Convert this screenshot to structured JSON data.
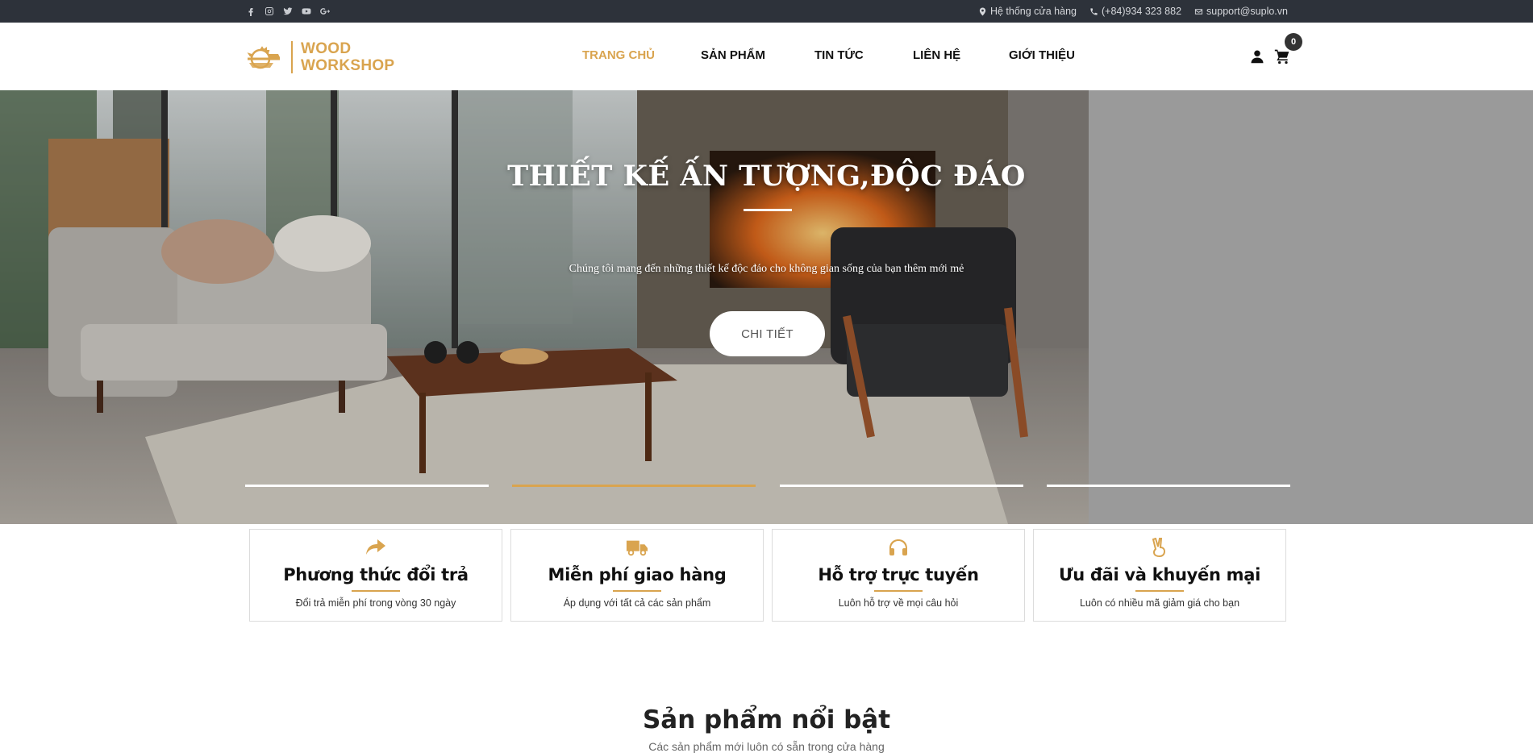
{
  "topbar": {
    "socials": [
      "facebook-icon",
      "instagram-icon",
      "twitter-icon",
      "youtube-icon",
      "google-plus-icon"
    ],
    "store_label": "Hệ thống cửa hàng",
    "phone": "(+84)934 323 882",
    "email": "support@suplo.vn"
  },
  "header": {
    "logo_line1": "WOOD",
    "logo_line2": "WORKSHOP",
    "nav": [
      "TRANG CHỦ",
      "SẢN PHẨM",
      "TIN TỨC",
      "LIÊN HỆ",
      "GIỚI THIỆU"
    ],
    "active_nav": "TRANG CHỦ",
    "cart_count": "0"
  },
  "hero": {
    "title": "THIẾT KẾ ẤN TƯỢNG,ĐỘC ĐÁO",
    "subtitle": "Chúng tôi mang đến những thiết kế độc đáo cho không gian sống của bạn thêm mới mẻ",
    "button": "CHI TIẾT",
    "slides": 4,
    "active_slide": 2
  },
  "features": [
    {
      "icon": "share-arrow-icon",
      "title": "Phương thức đổi trả",
      "desc": "Đổi trả miễn phí trong vòng 30 ngày"
    },
    {
      "icon": "truck-icon",
      "title": "Miễn phí giao hàng",
      "desc": "Áp dụng với tất cả các sản phẩm"
    },
    {
      "icon": "headphones-icon",
      "title": "Hỗ trợ trực tuyến",
      "desc": "Luôn hỗ trợ về mọi câu hỏi"
    },
    {
      "icon": "victory-hand-icon",
      "title": "Ưu đãi và khuyến mại",
      "desc": "Luôn có nhiều mã giảm giá cho bạn"
    }
  ],
  "section": {
    "title": "Sản phẩm nổi bật",
    "subtitle": "Các sản phẩm mới luôn có sẵn trong cửa hàng"
  },
  "colors": {
    "accent": "#d9a44f",
    "topbar_bg": "#2d323a",
    "hero_side": "#9a9a9a"
  }
}
